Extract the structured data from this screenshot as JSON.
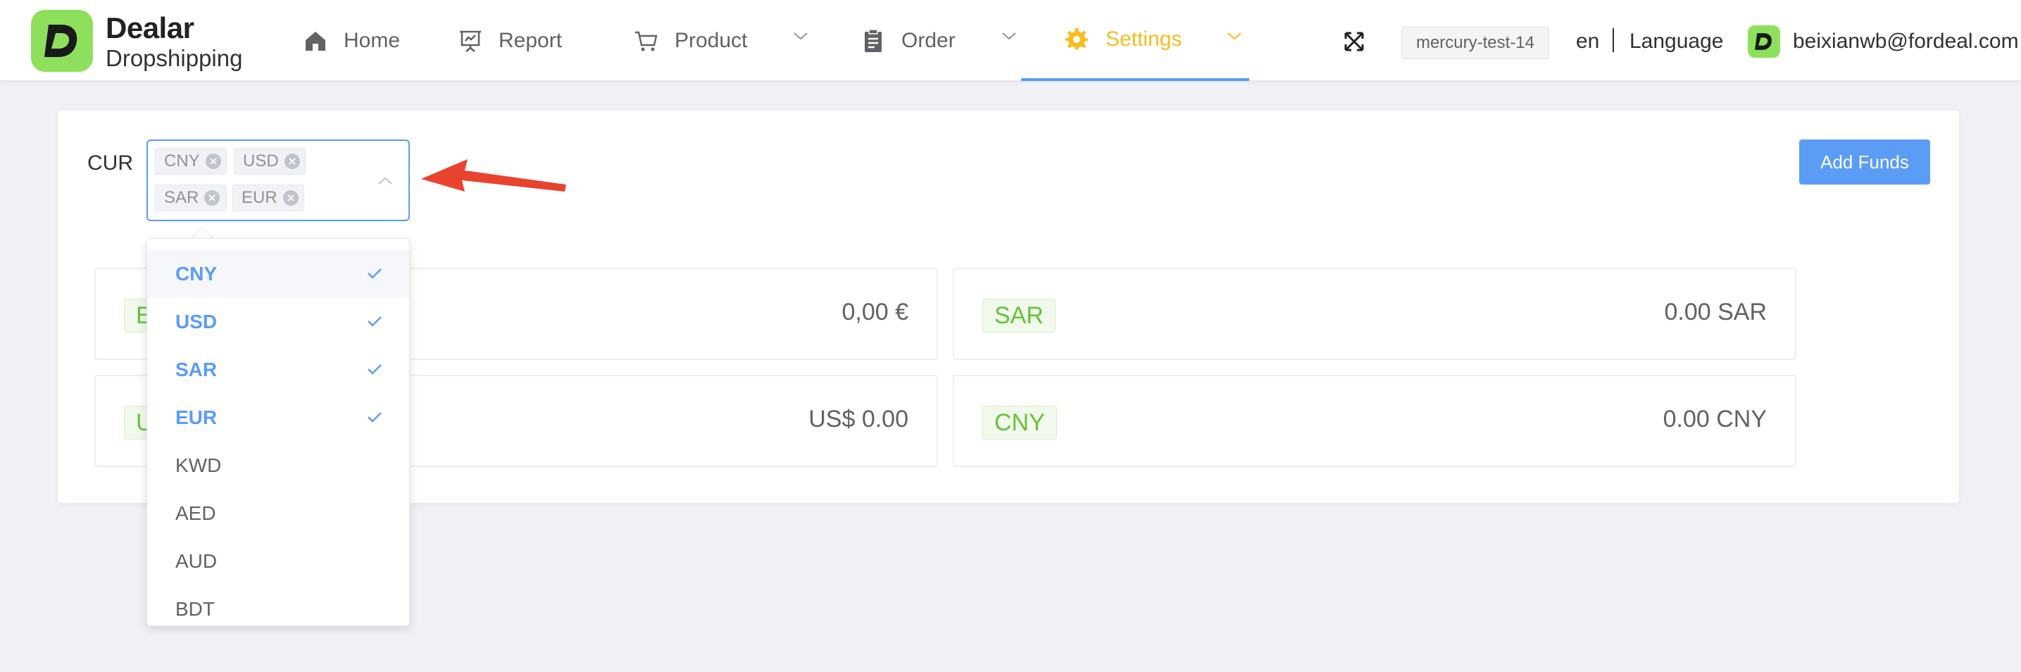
{
  "brand": {
    "title": "Dealar",
    "subtitle": "Dropshipping",
    "logo_color": "#8ee05c"
  },
  "nav": {
    "home": "Home",
    "report": "Report",
    "product": "Product",
    "order": "Order",
    "settings": "Settings",
    "active": "Settings",
    "active_color": "#f5be1e"
  },
  "header": {
    "store": "mercury-test-14",
    "lang_code": "en",
    "lang_label": "Language",
    "user_email": "beixianwb@fordeal.com"
  },
  "filter": {
    "label": "CUR",
    "selected_tags": [
      "CNY",
      "USD",
      "SAR",
      "EUR"
    ]
  },
  "actions": {
    "add_funds": "Add Funds",
    "accent": "#5b9cf5"
  },
  "balances": [
    {
      "currency": "EUR",
      "amount": "0,00 €"
    },
    {
      "currency": "SAR",
      "amount": "0.00 SAR"
    },
    {
      "currency": "USD",
      "amount": "US$ 0.00"
    },
    {
      "currency": "CNY",
      "amount": "0.00 CNY"
    }
  ],
  "dropdown": {
    "options": [
      {
        "label": "CNY",
        "selected": true
      },
      {
        "label": "USD",
        "selected": true
      },
      {
        "label": "SAR",
        "selected": true
      },
      {
        "label": "EUR",
        "selected": true
      },
      {
        "label": "KWD",
        "selected": false
      },
      {
        "label": "AED",
        "selected": false
      },
      {
        "label": "AUD",
        "selected": false
      },
      {
        "label": "BDT",
        "selected": false
      }
    ]
  },
  "annotation": {
    "type": "arrow",
    "color": "#e8432e"
  }
}
